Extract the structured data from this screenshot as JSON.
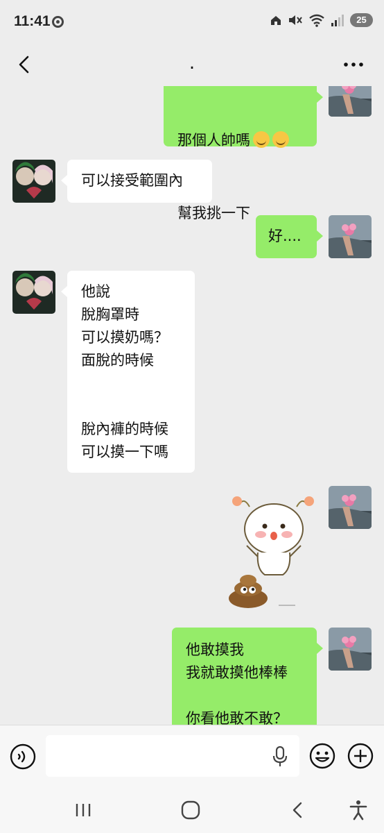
{
  "status_bar": {
    "time": "11:41",
    "battery": "25",
    "icons": [
      "chrome-icon",
      "home-network-icon",
      "mute-icon",
      "wifi-icon",
      "signal-icon"
    ]
  },
  "header": {
    "title": ".",
    "back_icon": "chevron-left-icon",
    "more_icon": "more-dots-icon"
  },
  "messages": [
    {
      "side": "out",
      "type": "text",
      "text": "那個人帥嗎",
      "emoji": [
        "☺️",
        "☺️"
      ],
      "text_line2": "幫我挑一下"
    },
    {
      "side": "in",
      "type": "text",
      "text": "可以接受範圍內"
    },
    {
      "side": "out",
      "type": "text",
      "text": "好...."
    },
    {
      "side": "in",
      "type": "text",
      "text": "他說\n脫胸罩時\n可以摸奶嗎？\n面脫的時候\n\n\n脫內褲的時候\n可以摸一下嗎"
    },
    {
      "side": "out",
      "type": "sticker",
      "sticker": "cute-bun-poop-sticker"
    },
    {
      "side": "out",
      "type": "text",
      "text": "他敢摸我\n我就敢摸他棒棒\n\n你看他敢不敢？"
    }
  ],
  "input_bar": {
    "value": "",
    "placeholder": "",
    "voice_icon": "voice-icon",
    "mic_icon": "microphone-icon",
    "emoji_icon": "emoji-icon",
    "plus_icon": "plus-circle-icon"
  },
  "nav_bar": {
    "icons": [
      "recent-apps-icon",
      "home-icon",
      "back-icon",
      "accessibility-icon"
    ]
  },
  "colors": {
    "background": "#ededed",
    "outgoing_bubble": "#95ec69",
    "incoming_bubble": "#ffffff",
    "bar": "#f7f7f7"
  }
}
